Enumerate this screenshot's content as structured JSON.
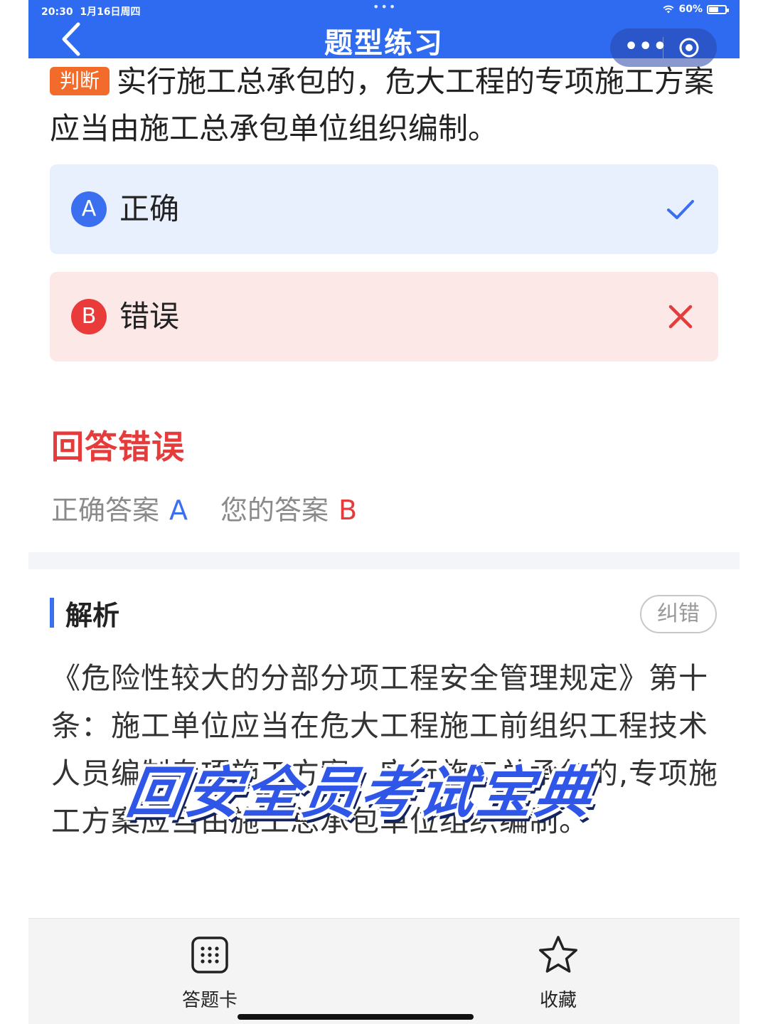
{
  "status_bar": {
    "time": "20:30",
    "date": "1月16日周四",
    "battery": "60%",
    "battery_fraction": 0.6
  },
  "header": {
    "title": "题型练习"
  },
  "question": {
    "tag": "判断",
    "text": "实行施工总承包的，危大工程的专项施工方案应当由施工总承包单位组织编制。"
  },
  "options": [
    {
      "letter": "A",
      "label": "正确",
      "state": "correct",
      "icon": "check-icon"
    },
    {
      "letter": "B",
      "label": "错误",
      "state": "wrong",
      "icon": "cross-icon"
    }
  ],
  "result": {
    "title": "回答错误",
    "correct_label": "正确答案",
    "correct_value": "A",
    "yours_label": "您的答案",
    "yours_value": "B"
  },
  "analysis": {
    "title": "解析",
    "report_button": "纠错",
    "text": "《危险性较大的分部分项工程安全管理规定》第十条：施工单位应当在危大工程施工前组织工程技术人员编制专项施工方案。实行施工总承包的,专项施工方案应当由施工总承包单位组织编制。"
  },
  "watermark": "回安全员考试宝典",
  "bottom_bar": {
    "answer_card": "答题卡",
    "favorite": "收藏"
  },
  "colors": {
    "primary": "#2f6bf0",
    "error": "#e63b3b",
    "tag": "#f26b2a"
  }
}
